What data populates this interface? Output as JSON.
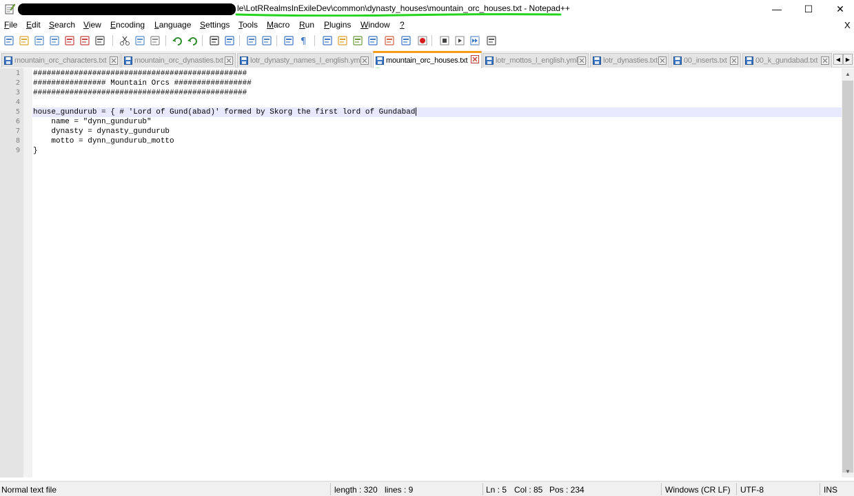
{
  "window": {
    "title_visible": "le\\LotRRealmsInExileDev\\common\\dynasty_houses\\mountain_orc_houses.txt - Notepad++",
    "minimize_glyph": "—",
    "maximize_glyph": "☐",
    "close_glyph": "✕"
  },
  "menu": {
    "items": [
      {
        "underline": "F",
        "rest": "ile"
      },
      {
        "underline": "E",
        "rest": "dit"
      },
      {
        "underline": "S",
        "rest": "earch"
      },
      {
        "underline": "V",
        "rest": "iew"
      },
      {
        "underline": "E",
        "rest": "ncoding"
      },
      {
        "underline": "L",
        "rest": "anguage"
      },
      {
        "underline": "S",
        "rest": "ettings"
      },
      {
        "underline": "T",
        "rest": "ools"
      },
      {
        "underline": "M",
        "rest": "acro"
      },
      {
        "underline": "R",
        "rest": "un"
      },
      {
        "underline": "P",
        "rest": "lugins"
      },
      {
        "underline": "W",
        "rest": "indow"
      },
      {
        "underline": "?",
        "rest": ""
      }
    ],
    "close_doc": "X"
  },
  "toolbar": {
    "icons": [
      "new-file-icon",
      "open-file-icon",
      "save-icon",
      "save-all-icon",
      "close-icon",
      "close-all-icon",
      "print-icon",
      "cut-icon",
      "copy-icon",
      "paste-icon",
      "undo-icon",
      "redo-icon",
      "find-icon",
      "replace-icon",
      "zoom-in-icon",
      "zoom-out-icon",
      "sync-scroll-icon",
      "show-all-chars-icon",
      "indent-guide-icon",
      "user-lang-icon",
      "doc-map-icon",
      "function-list-icon",
      "folder-workspace-icon",
      "monitoring-icon",
      "record-macro-icon",
      "stop-record-icon",
      "play-macro-icon",
      "run-macro-multiple-icon",
      "save-macro-icon"
    ]
  },
  "tabs": [
    {
      "label": "mountain_orc_characters.txt",
      "active": false
    },
    {
      "label": "mountain_orc_dynasties.txt",
      "active": false
    },
    {
      "label": "lotr_dynasty_names_l_english.yml",
      "active": false
    },
    {
      "label": "mountain_orc_houses.txt",
      "active": true
    },
    {
      "label": "lotr_mottos_l_english.yml",
      "active": false
    },
    {
      "label": "lotr_dynasties.txt",
      "active": false
    },
    {
      "label": "00_inserts.txt",
      "active": false
    },
    {
      "label": "00_k_gundabad.txt",
      "active": false
    }
  ],
  "editor": {
    "lines": [
      {
        "num": "1",
        "text": "###############################################"
      },
      {
        "num": "2",
        "text": "################ Mountain Orcs #################"
      },
      {
        "num": "3",
        "text": "###############################################"
      },
      {
        "num": "4",
        "text": ""
      },
      {
        "num": "5",
        "text": "house_gundurub = { # 'Lord of Gund(abad)' formed by Skorg the first lord of Gundabad"
      },
      {
        "num": "6",
        "text": "    name = \"dynn_gundurub\""
      },
      {
        "num": "7",
        "text": "    dynasty = dynasty_gundurub"
      },
      {
        "num": "8",
        "text": "    motto = dynn_gundurub_motto"
      },
      {
        "num": "9",
        "text": "}"
      }
    ],
    "current_line": 5
  },
  "status": {
    "file_type": "Normal text file",
    "length": "length : 320",
    "lines": "lines : 9",
    "ln": "Ln : 5",
    "col": "Col : 85",
    "pos": "Pos : 234",
    "eol": "Windows (CR LF)",
    "encoding": "UTF-8",
    "mode": "INS"
  },
  "colors": {
    "active_tab_accent": "#fa9b1a",
    "annotation_green": "#22d41e",
    "current_line_bg": "#e8e8ff"
  }
}
